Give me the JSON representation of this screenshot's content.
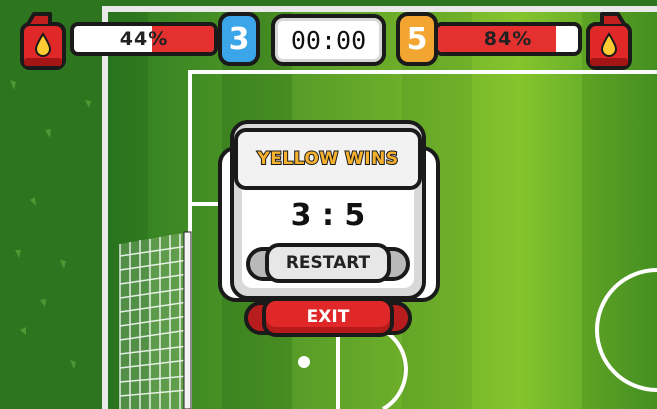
{
  "hud": {
    "left_player": {
      "fuel_label": "44%",
      "fuel_fraction": 0.44,
      "score": "3",
      "badge_color": "#3aa5e8",
      "fuel_icon": "fuel-can-icon"
    },
    "timer": "00:00",
    "right_player": {
      "fuel_label": "84%",
      "fuel_fraction": 0.84,
      "score": "5",
      "badge_color": "#f2a531",
      "fuel_icon": "fuel-can-icon"
    }
  },
  "dialog": {
    "title": "YELLOW WINS",
    "final_score": "3 : 5",
    "restart_label": "RESTART",
    "exit_label": "EXIT"
  },
  "colors": {
    "fuel_fill": "#e53030",
    "field_light": "#8cc62a",
    "field_dark": "#3a8a24",
    "title_yellow": "#f6b22e",
    "exit_red": "#e02828"
  }
}
